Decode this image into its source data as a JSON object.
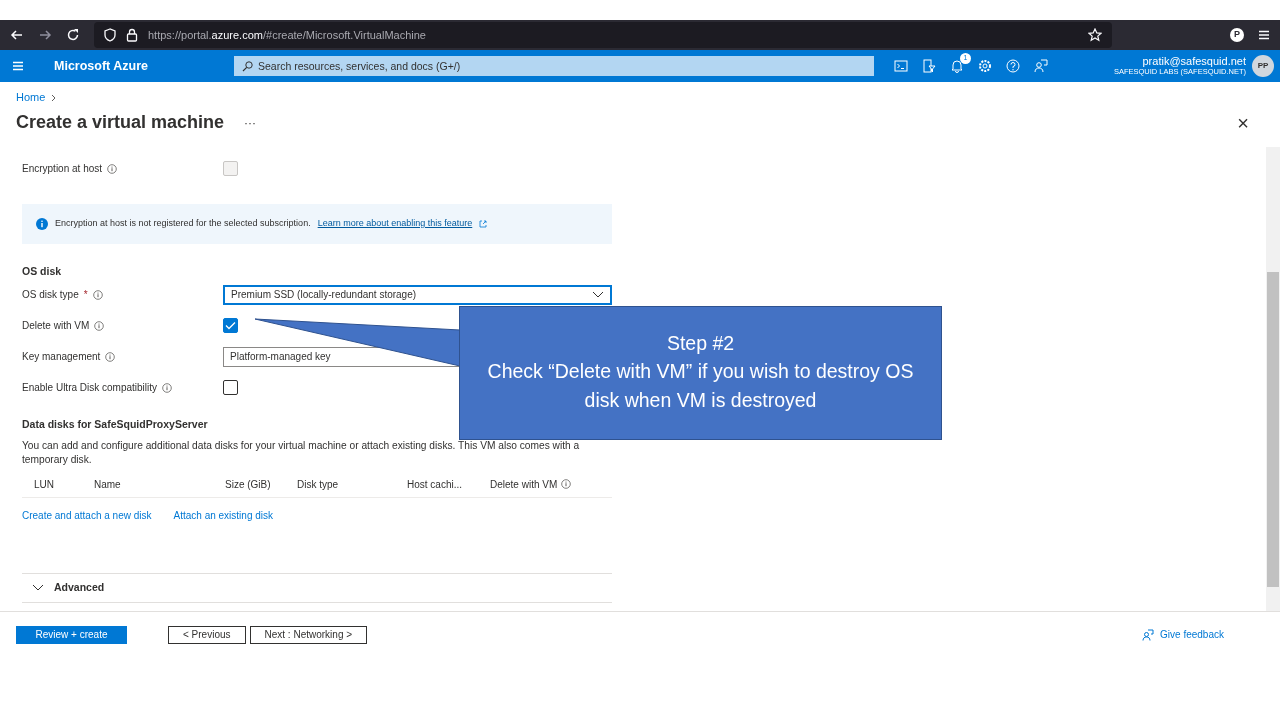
{
  "browser": {
    "url_prefix": "https://portal.",
    "url_domain": "azure.com",
    "url_path": "/#create/Microsoft.VirtualMachine",
    "profile": "P"
  },
  "portal": {
    "brand": "Microsoft Azure",
    "search": {
      "placeholder": "Search resources, services, and docs (G+/)"
    },
    "notification_count": "1",
    "user_email": "pratik@safesquid.net",
    "user_org": "SAFESQUID LABS (SAFESQUID.NET)",
    "avatar": "PP"
  },
  "breadcrumb": [
    "Home"
  ],
  "page": {
    "title": "Create a virtual machine",
    "more": "···",
    "close": "×"
  },
  "form": [
    {
      "kind": "checkbox",
      "label": "Encryption at host",
      "checked": false,
      "disabled": true
    },
    {
      "kind": "info",
      "text": "Encryption at host is not registered for the selected subscription.",
      "link": "Learn more about enabling this feature"
    },
    {
      "kind": "heading",
      "label": "OS disk"
    },
    {
      "kind": "select",
      "label": "OS disk type",
      "required_mark": "*",
      "value": "Premium SSD (locally-redundant storage)",
      "focused": true,
      "dropdown_arrow": true
    },
    {
      "kind": "checkbox",
      "label": "Delete with VM",
      "checked": true,
      "disabled": false
    },
    {
      "kind": "select",
      "label": "Key management",
      "value": "Platform-managed key",
      "focused": false
    },
    {
      "kind": "checkbox",
      "label": "Enable Ultra Disk compatibility",
      "checked": false,
      "disabled": false
    },
    {
      "kind": "heading",
      "label": "Data disks for SafeSquidProxyServer"
    },
    {
      "kind": "text",
      "text": "You can add and configure additional data disks for your virtual machine or attach existing disks. This VM also comes with a temporary disk."
    }
  ],
  "table": {
    "columns": [
      "LUN",
      "Name",
      "Size (GiB)",
      "Disk type",
      "Host cachi...",
      "Delete with VM"
    ]
  },
  "disk_links": [
    "Create and attach a new disk",
    "Attach an existing disk"
  ],
  "advanced": {
    "label": "Advanced",
    "expanded": false
  },
  "footer": {
    "buttons": [
      {
        "label": "Review + create",
        "kind": "primary"
      },
      {
        "label": "< Previous",
        "kind": "secondary"
      },
      {
        "label": "Next : Networking >",
        "kind": "secondary"
      }
    ],
    "feedback": "Give feedback"
  },
  "callout": {
    "title": "Step #2",
    "text": "Check “Delete with VM” if you wish to destroy OS disk when VM is destroyed"
  }
}
